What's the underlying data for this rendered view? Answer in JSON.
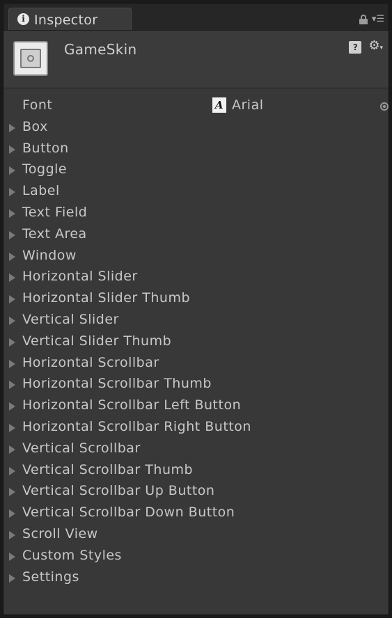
{
  "tab": {
    "label": "Inspector",
    "icon": "info-icon"
  },
  "header": {
    "asset_name": "GameSkin",
    "asset_icon": "guiskin-icon"
  },
  "font_row": {
    "label": "Font",
    "value": "Arial",
    "badge": "A"
  },
  "items": [
    "Box",
    "Button",
    "Toggle",
    "Label",
    "Text Field",
    "Text Area",
    "Window",
    "Horizontal Slider",
    "Horizontal Slider Thumb",
    "Vertical Slider",
    "Vertical Slider Thumb",
    "Horizontal Scrollbar",
    "Horizontal Scrollbar Thumb",
    "Horizontal Scrollbar Left Button",
    "Horizontal Scrollbar Right Button",
    "Vertical Scrollbar",
    "Vertical Scrollbar Thumb",
    "Vertical Scrollbar Up Button",
    "Vertical Scrollbar Down Button",
    "Scroll View",
    "Custom Styles",
    "Settings"
  ]
}
